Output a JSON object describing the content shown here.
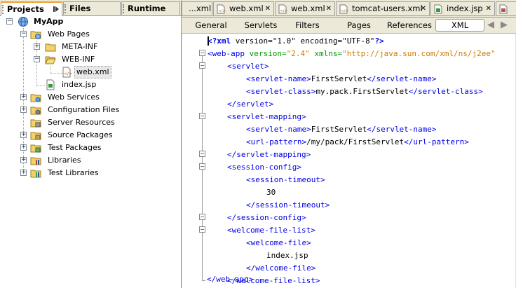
{
  "left_tabs": [
    {
      "label": "Projects",
      "active": true
    },
    {
      "label": "Files",
      "active": false
    },
    {
      "label": "Runtime",
      "active": false
    }
  ],
  "tree": [
    {
      "label": "MyApp",
      "bold": true
    },
    {
      "label": "Web Pages"
    },
    {
      "label": "META-INF"
    },
    {
      "label": "WEB-INF"
    },
    {
      "label": "web.xml",
      "selected": true
    },
    {
      "label": "index.jsp"
    },
    {
      "label": "Web Services"
    },
    {
      "label": "Configuration Files"
    },
    {
      "label": "Server Resources"
    },
    {
      "label": "Source Packages"
    },
    {
      "label": "Test Packages"
    },
    {
      "label": "Libraries"
    },
    {
      "label": "Test Libraries"
    }
  ],
  "doc_tabs": [
    {
      "label": "...xml"
    },
    {
      "label": "web.xml"
    },
    {
      "label": "web.xml"
    },
    {
      "label": "tomcat-users.xml"
    },
    {
      "label": "index.jsp"
    }
  ],
  "view_buttons": [
    {
      "label": "General"
    },
    {
      "label": "Servlets"
    },
    {
      "label": "Filters"
    },
    {
      "label": "Pages"
    },
    {
      "label": "References"
    },
    {
      "label": "XML",
      "active": true
    }
  ],
  "code": {
    "l1_pi_open": "<?xml",
    "l1_attrs": " version=\"1.0\" encoding=\"UTF-8\"",
    "l1_pi_close": "?>",
    "l2_tag": "<web-app",
    "l2_attr1": " version=",
    "l2_val1": "\"2.4\"",
    "l2_attr2": " xmlns=",
    "l2_val2": "\"http://java.sun.com/xml/ns/j2ee\"",
    "l3": "<servlet>",
    "l4_open": "<servlet-name>",
    "l4_text": "FirstServlet",
    "l4_close": "</servlet-name>",
    "l5_open": "<servlet-class>",
    "l5_text": "my.pack.FirstServlet",
    "l5_close": "</servlet-class>",
    "l6": "</servlet>",
    "l7": "<servlet-mapping>",
    "l8_open": "<servlet-name>",
    "l8_text": "FirstServlet",
    "l8_close": "</servlet-name>",
    "l9_open": "<url-pattern>",
    "l9_text": "/my/pack/FirstServlet",
    "l9_close": "</url-pattern>",
    "l10": "</servlet-mapping>",
    "l11": "<session-config>",
    "l12": "<session-timeout>",
    "l13": "30",
    "l14": "</session-timeout>",
    "l15": "</session-config>",
    "l16": "<welcome-file-list>",
    "l17": "<welcome-file>",
    "l18": "index.jsp",
    "l19": "</welcome-file>",
    "l20": "</welcome-file-list>",
    "l21": "</web-app>"
  }
}
